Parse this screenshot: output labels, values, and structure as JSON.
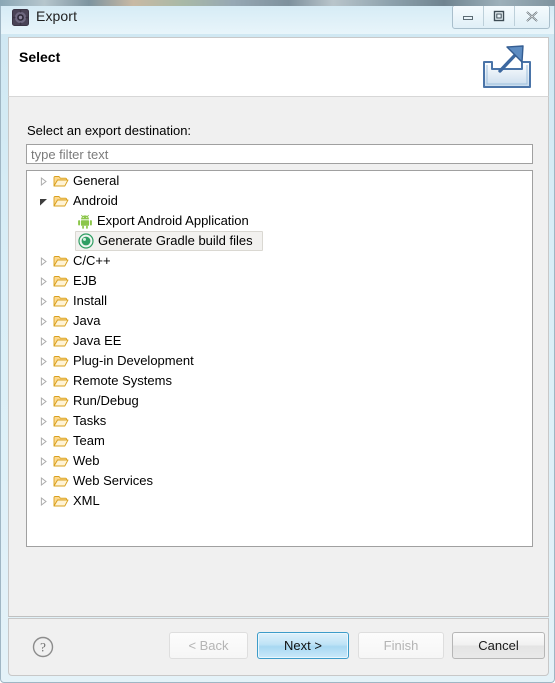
{
  "window": {
    "title": "Export",
    "app_icon": "eclipse-icon",
    "controls": [
      {
        "name": "minimize-button",
        "glyph": "minimize-icon"
      },
      {
        "name": "maximize-button",
        "glyph": "maximize-icon"
      },
      {
        "name": "close-button",
        "glyph": "close-icon"
      }
    ]
  },
  "header": {
    "title": "Select",
    "graphic": "export-wizard-icon"
  },
  "main": {
    "destination_label": "Select an export destination:",
    "filter": {
      "value": "",
      "placeholder": "type filter text"
    },
    "tree": [
      {
        "label": "General",
        "icon": "folder-icon",
        "depth": 0,
        "state": "collapsed",
        "selected": false
      },
      {
        "label": "Android",
        "icon": "folder-icon",
        "depth": 0,
        "state": "expanded",
        "selected": false
      },
      {
        "label": "Export Android Application",
        "icon": "android-robot-icon",
        "depth": 1,
        "state": "leaf",
        "selected": false
      },
      {
        "label": "Generate Gradle build files",
        "icon": "gradle-icon",
        "depth": 1,
        "state": "leaf",
        "selected": true
      },
      {
        "label": "C/C++",
        "icon": "folder-icon",
        "depth": 0,
        "state": "collapsed",
        "selected": false
      },
      {
        "label": "EJB",
        "icon": "folder-icon",
        "depth": 0,
        "state": "collapsed",
        "selected": false
      },
      {
        "label": "Install",
        "icon": "folder-icon",
        "depth": 0,
        "state": "collapsed",
        "selected": false
      },
      {
        "label": "Java",
        "icon": "folder-icon",
        "depth": 0,
        "state": "collapsed",
        "selected": false
      },
      {
        "label": "Java EE",
        "icon": "folder-icon",
        "depth": 0,
        "state": "collapsed",
        "selected": false
      },
      {
        "label": "Plug-in Development",
        "icon": "folder-icon",
        "depth": 0,
        "state": "collapsed",
        "selected": false
      },
      {
        "label": "Remote Systems",
        "icon": "folder-icon",
        "depth": 0,
        "state": "collapsed",
        "selected": false
      },
      {
        "label": "Run/Debug",
        "icon": "folder-icon",
        "depth": 0,
        "state": "collapsed",
        "selected": false
      },
      {
        "label": "Tasks",
        "icon": "folder-icon",
        "depth": 0,
        "state": "collapsed",
        "selected": false
      },
      {
        "label": "Team",
        "icon": "folder-icon",
        "depth": 0,
        "state": "collapsed",
        "selected": false
      },
      {
        "label": "Web",
        "icon": "folder-icon",
        "depth": 0,
        "state": "collapsed",
        "selected": false
      },
      {
        "label": "Web Services",
        "icon": "folder-icon",
        "depth": 0,
        "state": "collapsed",
        "selected": false
      },
      {
        "label": "XML",
        "icon": "folder-icon",
        "depth": 0,
        "state": "collapsed",
        "selected": false
      }
    ]
  },
  "footer": {
    "help_icon": "help-question-icon",
    "buttons": {
      "back": {
        "label": "< Back",
        "enabled": false,
        "primary": false
      },
      "next": {
        "label": "Next >",
        "enabled": true,
        "primary": true
      },
      "finish": {
        "label": "Finish",
        "enabled": false,
        "primary": false
      },
      "cancel": {
        "label": "Cancel",
        "enabled": true,
        "primary": false
      }
    }
  },
  "colors": {
    "titlebar_top": "#d2eaf5",
    "window_border": "#9fb6c4",
    "panel_bg": "#f0f0f0",
    "tree_bg": "#ffffff",
    "folder_fill": "#fcd88f",
    "folder_stroke": "#d9a11e",
    "android_green": "#8cc64b",
    "gradle_green": "#2f9e63",
    "primary_button_border": "#3d9cc9",
    "selection_bg": "#f2f1ef"
  }
}
